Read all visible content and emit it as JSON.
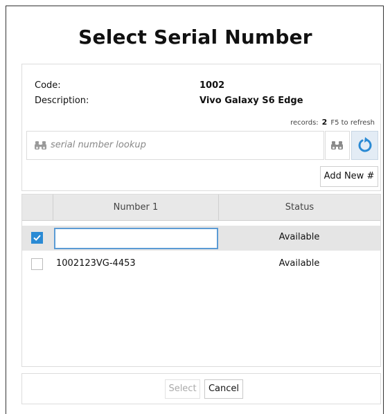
{
  "dialog": {
    "title": "Select Serial Number"
  },
  "info": {
    "code_label": "Code:",
    "code_value": "1002",
    "description_label": "Description:",
    "description_value": "Vivo Galaxy S6 Edge",
    "records_label": "records:",
    "records_count": "2",
    "refresh_hint": "F5 to refresh"
  },
  "lookup": {
    "placeholder": "serial number lookup",
    "icon": "binoculars-icon"
  },
  "buttons": {
    "find_icon": "binoculars-icon",
    "refresh_icon": "refresh-icon",
    "add_new_label": "Add New #"
  },
  "grid": {
    "columns": [
      "",
      "Number 1",
      "Status"
    ],
    "rows": [
      {
        "checked": true,
        "number": "",
        "status": "Available",
        "editing": true
      },
      {
        "checked": false,
        "number": "1002123VG-4453",
        "status": "Available",
        "editing": false
      }
    ]
  },
  "footer": {
    "select_label": "Select",
    "cancel_label": "Cancel"
  },
  "colors": {
    "accent": "#2a8ad4",
    "refresh_bg": "#e3ecf5",
    "header_bg": "#e8e8e8",
    "selected_row_bg": "#e5e5e5"
  }
}
